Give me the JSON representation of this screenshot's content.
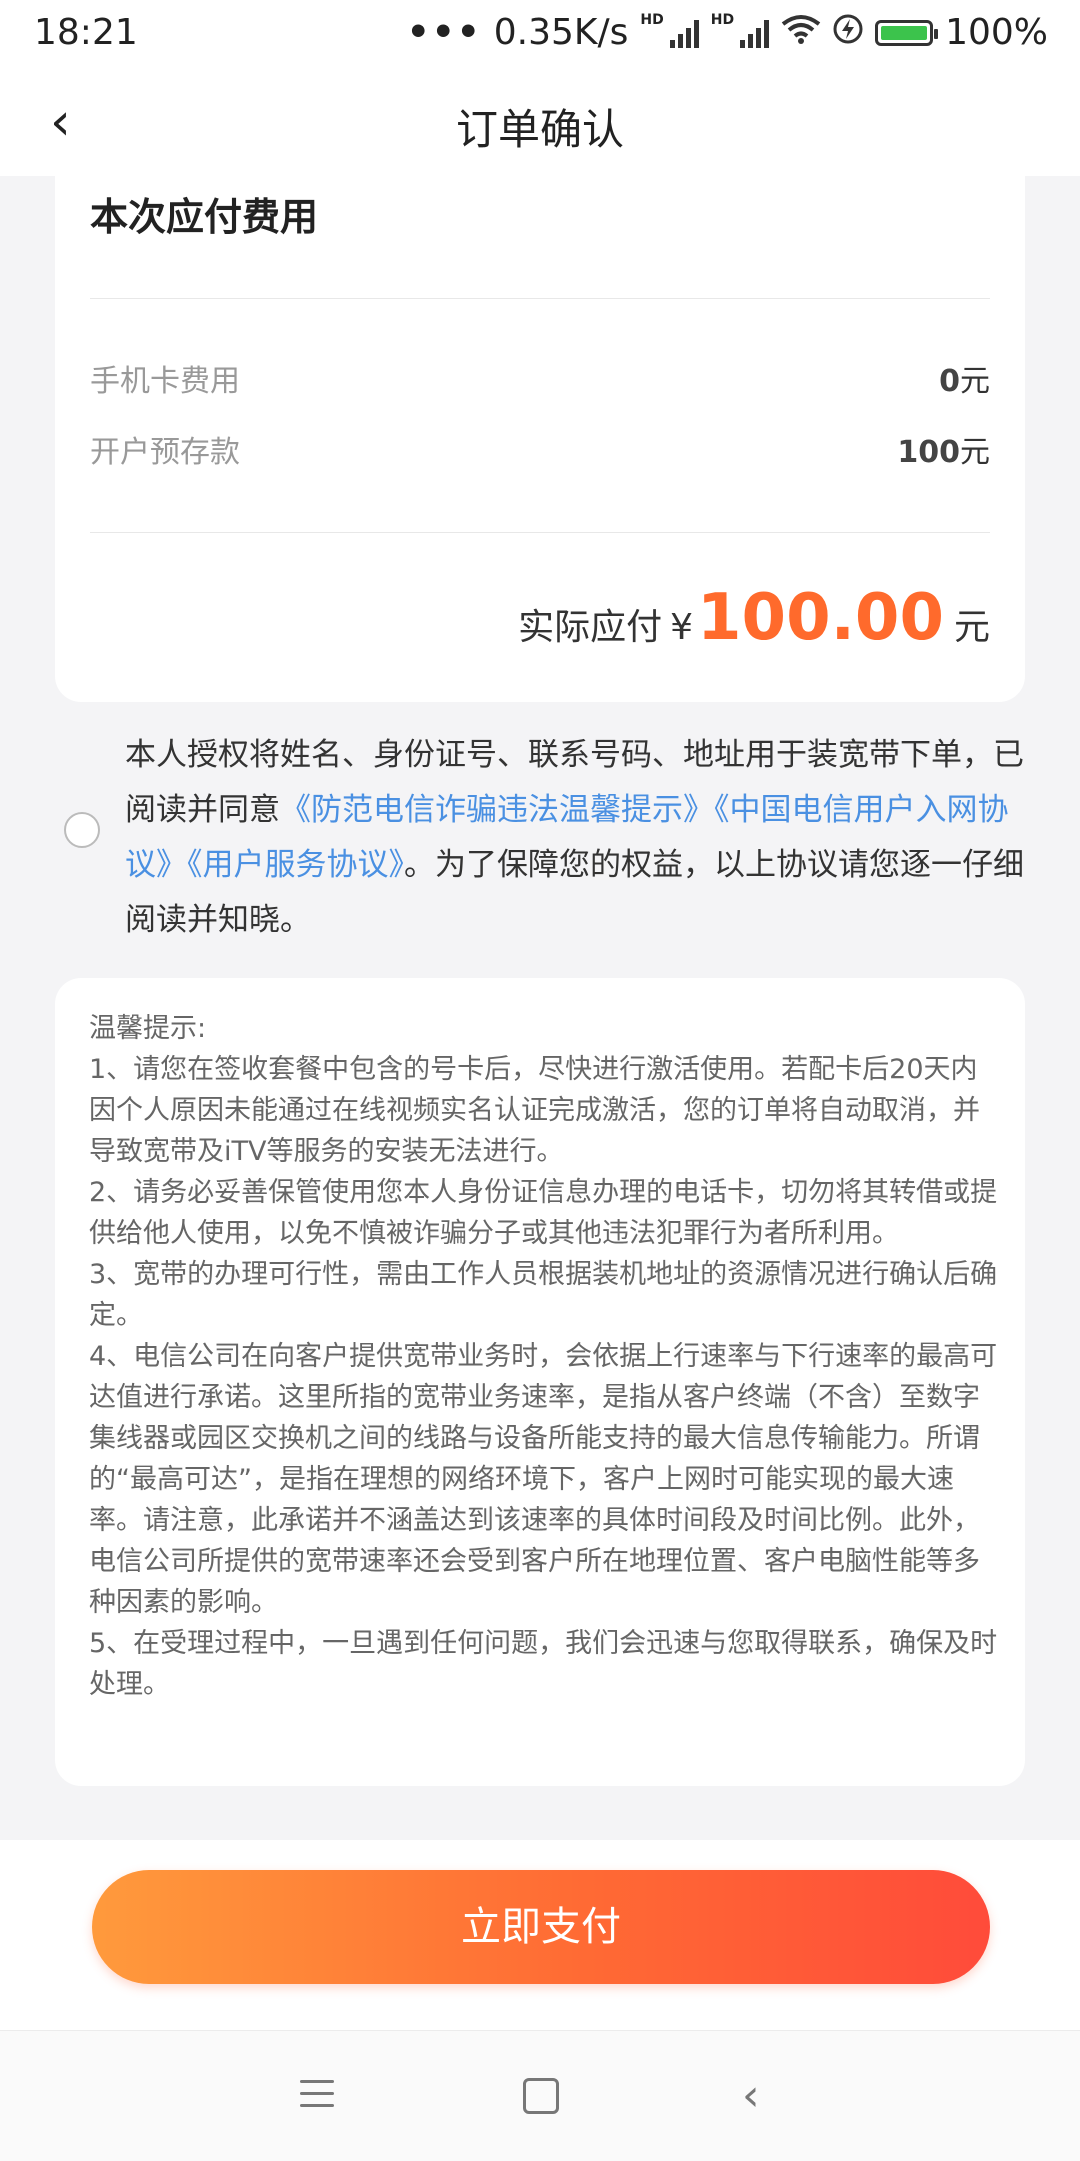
{
  "status_bar": {
    "time": "18:21",
    "dots": "•••",
    "speed": "0.35K/s",
    "hd1": "HD",
    "hd2": "HD",
    "battery": "100%"
  },
  "nav": {
    "back": "‹",
    "title": "订单确认"
  },
  "fee": {
    "title": "本次应付费用",
    "rows": [
      {
        "label": "手机卡费用",
        "amount": "0",
        "unit": "元"
      },
      {
        "label": "开户预存款",
        "amount": "100",
        "unit": "元"
      }
    ],
    "total_label": "实际应付",
    "total_yen": "¥",
    "total_amount": "100.00",
    "total_unit": "元"
  },
  "agreement": {
    "text_before": "本人授权将姓名、身份证号、联系号码、地址用于装宽带下单，已阅读并同意",
    "link1": "《防范电信诈骗违法温馨提示》",
    "link2": "《中国电信用户入网协议》",
    "link3": "《用户服务协议》",
    "text_after": "。为了保障您的权益，以上协议请您逐一仔细阅读并知晓。",
    "checked": false
  },
  "tips": {
    "title": "温馨提示:",
    "items": [
      "1、请您在签收套餐中包含的号卡后，尽快进行激活使用。若配卡后20天内因个人原因未能通过在线视频实名认证完成激活，您的订单将自动取消，并导致宽带及iTV等服务的安装无法进行。",
      "2、请务必妥善保管使用您本人身份证信息办理的电话卡，切勿将其转借或提供给他人使用，以免不慎被诈骗分子或其他违法犯罪行为者所利用。",
      "3、宽带的办理可行性，需由工作人员根据装机地址的资源情况进行确认后确定。",
      "4、电信公司在向客户提供宽带业务时，会依据上行速率与下行速率的最高可达值进行承诺。这里所指的宽带业务速率，是指从客户终端（不含）至数字集线器或园区交换机之间的线路与设备所能支持的最大信息传输能力。所谓的“最高可达”，是指在理想的网络环境下，客户上网时可能实现的最大速率。请注意，此承诺并不涵盖达到该速率的具体时间段及时间比例。此外，电信公司所提供的宽带速率还会受到客户所在地理位置、客户电脑性能等多种因素的影响。",
      "5、在受理过程中，一旦遇到任何问题，我们会迅速与您取得联系，确保及时处理。"
    ]
  },
  "footer": {
    "pay_button": "立即支付"
  },
  "colors": {
    "accent": "#ff6a2c",
    "link": "#4a90e2",
    "button_start": "#ff9a3c",
    "button_end": "#ff4b3a"
  }
}
